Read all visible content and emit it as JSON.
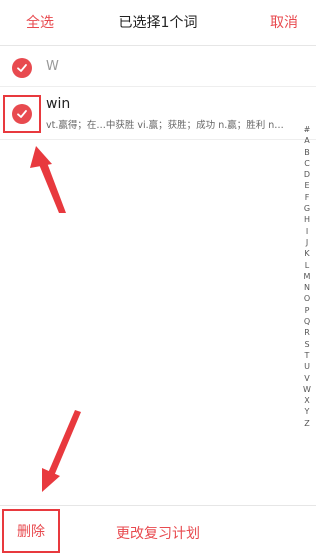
{
  "header": {
    "select_all": "全选",
    "title": "已选择1个词",
    "cancel": "取消"
  },
  "group": {
    "letter": "W",
    "checked": true
  },
  "words": [
    {
      "word": "win",
      "definition": "vt.赢得；在…中获胜 vi.赢；获胜；成功 n.赢；胜利 n…",
      "checked": true
    }
  ],
  "index_letters": [
    "#",
    "A",
    "B",
    "C",
    "D",
    "E",
    "F",
    "G",
    "H",
    "I",
    "J",
    "K",
    "L",
    "M",
    "N",
    "O",
    "P",
    "Q",
    "R",
    "S",
    "T",
    "U",
    "V",
    "W",
    "X",
    "Y",
    "Z"
  ],
  "footer": {
    "delete": "删除",
    "change_plan": "更改复习计划"
  },
  "colors": {
    "accent": "#e84a4f",
    "highlight": "#e8393e"
  }
}
